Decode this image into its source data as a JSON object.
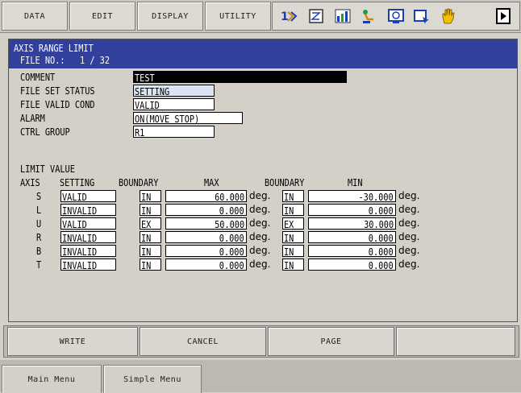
{
  "top_menu": {
    "data": "DATA",
    "edit": "EDIT",
    "display": "DISPLAY",
    "utility": "UTILITY"
  },
  "toolbar_icons": [
    "coordinate-icon",
    "job-zoom-icon",
    "graph-icon",
    "robot-arm-icon",
    "monitor-icon",
    "edit-pointer-icon",
    "hand-icon",
    "play-icon"
  ],
  "screen": {
    "title": "AXIS RANGE LIMIT",
    "file_no_label": "FILE NO.:",
    "file_no_value": "1 / 32",
    "comment_label": "COMMENT",
    "comment_value": "TEST",
    "file_set_status_label": "FILE SET STATUS",
    "file_set_status_value": "SETTING",
    "file_valid_cond_label": "FILE VALID COND",
    "file_valid_cond_value": "VALID",
    "alarm_label": "ALARM",
    "alarm_value": "ON(MOVE STOP)",
    "ctrl_group_label": "CTRL GROUP",
    "ctrl_group_value": "R1",
    "limit_value_label": "LIMIT VALUE",
    "headers": {
      "axis": "AXIS",
      "setting": "SETTING",
      "boundary_max": "BOUNDARY",
      "max": "MAX",
      "boundary_min": "BOUNDARY",
      "min": "MIN"
    },
    "unit": "deg.",
    "rows": [
      {
        "axis": "S",
        "setting": "VALID",
        "boundary_max": "IN",
        "max": "60.000",
        "boundary_min": "IN",
        "min": "-30.000"
      },
      {
        "axis": "L",
        "setting": "INVALID",
        "boundary_max": "IN",
        "max": "0.000",
        "boundary_min": "IN",
        "min": "0.000"
      },
      {
        "axis": "U",
        "setting": "VALID",
        "boundary_max": "EX",
        "max": "50.000",
        "boundary_min": "EX",
        "min": "30.000"
      },
      {
        "axis": "R",
        "setting": "INVALID",
        "boundary_max": "IN",
        "max": "0.000",
        "boundary_min": "IN",
        "min": "0.000"
      },
      {
        "axis": "B",
        "setting": "INVALID",
        "boundary_max": "IN",
        "max": "0.000",
        "boundary_min": "IN",
        "min": "0.000"
      },
      {
        "axis": "T",
        "setting": "INVALID",
        "boundary_max": "IN",
        "max": "0.000",
        "boundary_min": "IN",
        "min": "0.000"
      }
    ]
  },
  "function_keys": {
    "write": "WRITE",
    "cancel": "CANCEL",
    "page": "PAGE",
    "blank": ""
  },
  "bottom_menu": {
    "main_menu": "Main Menu",
    "simple_menu": "Simple Menu"
  },
  "colors": {
    "title_bar": "#31409a",
    "comment_field": "#000000",
    "selected_field": "#dbe4f3"
  }
}
